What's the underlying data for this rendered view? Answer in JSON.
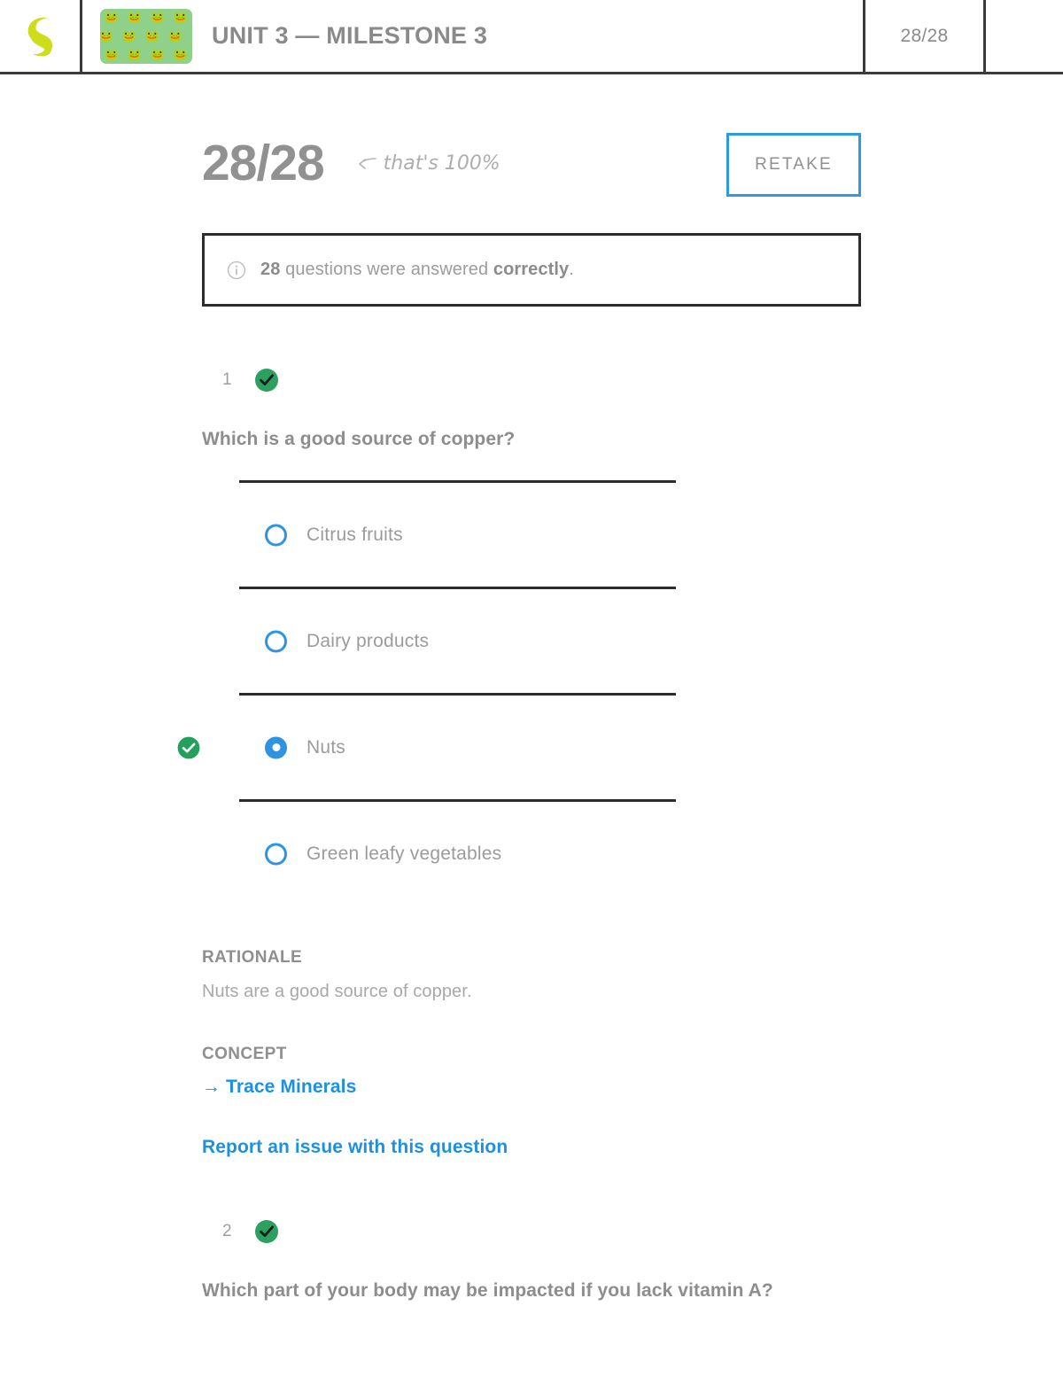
{
  "header": {
    "logo_icon": "sophia-logo",
    "thumbnail_icon": "frog-pattern-thumbnail",
    "title": "UNIT 3 — MILESTONE 3",
    "score": "28/28"
  },
  "summary": {
    "score": "28/28",
    "annotation": "that's 100%",
    "annotation_arrow_icon": "curved-left-arrow-icon",
    "retake_label": "RETAKE",
    "info_icon": "info-circle-icon",
    "info_count": "28",
    "info_middle": " questions were answered ",
    "info_emphasis": "correctly",
    "info_end": "."
  },
  "colors": {
    "accent_blue": "#2e93e0",
    "correct_green": "#22a05c",
    "text_gray": "#9b9b9b",
    "border_dark": "#2d2d2d",
    "logo_green": "#cddc1b"
  },
  "questions": [
    {
      "number": "1",
      "status_icon": "check-circle-icon",
      "prompt": "Which is a good source of copper?",
      "options": [
        {
          "label": "Citrus fruits",
          "selected": false,
          "correct": false
        },
        {
          "label": "Dairy products",
          "selected": false,
          "correct": false
        },
        {
          "label": "Nuts",
          "selected": true,
          "correct": true
        },
        {
          "label": "Green leafy vegetables",
          "selected": false,
          "correct": false
        }
      ],
      "rationale_title": "RATIONALE",
      "rationale_body": "Nuts are a good source of copper.",
      "concept_title": "CONCEPT",
      "concept_link": "Trace Minerals",
      "report_link": "Report an issue with this question"
    },
    {
      "number": "2",
      "status_icon": "check-circle-icon",
      "prompt": "Which part of your body may be impacted if you lack vitamin A?"
    }
  ]
}
